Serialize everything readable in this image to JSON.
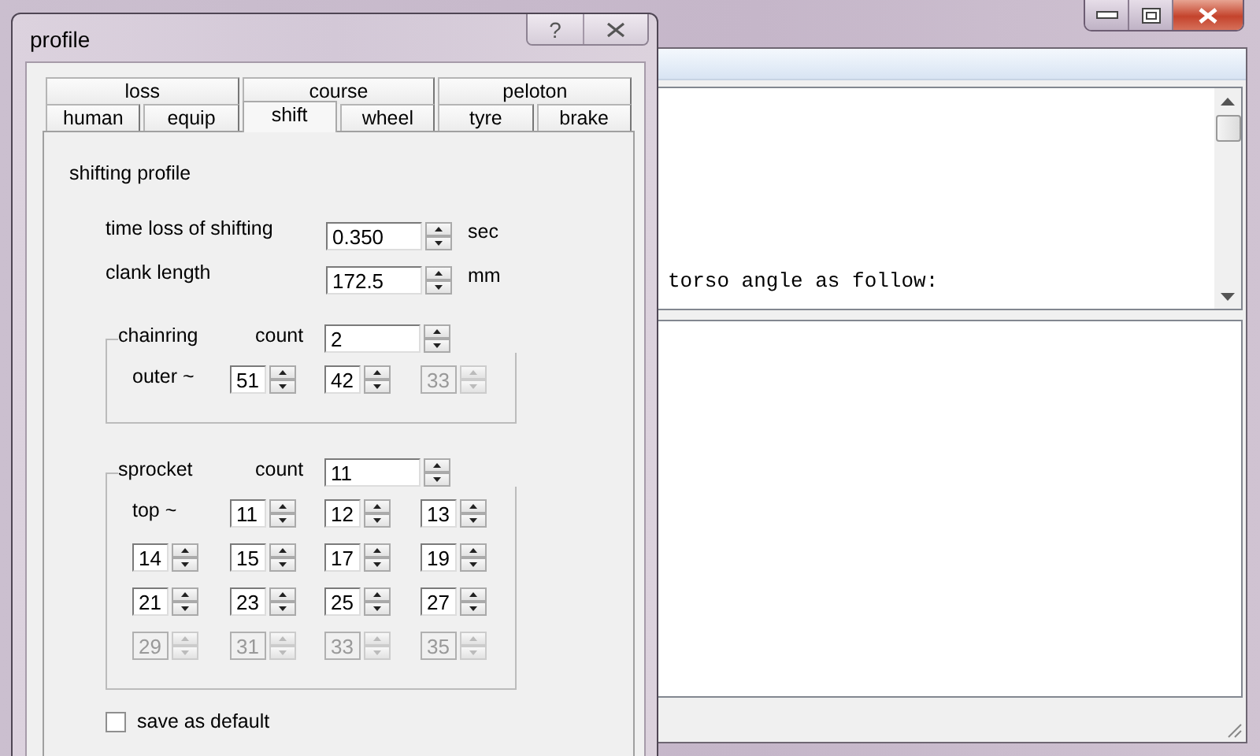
{
  "main_window": {
    "text_pane": {
      "lines": [
        "torso angle as follow:"
      ]
    }
  },
  "dialog": {
    "title": "profile",
    "help_button": "?",
    "tab_rows": [
      [
        {
          "label": "loss",
          "selected": false
        },
        {
          "label": "course",
          "selected": false
        },
        {
          "label": "peloton",
          "selected": false
        }
      ],
      [
        {
          "label": "human",
          "selected": false
        },
        {
          "label": "equip",
          "selected": false
        },
        {
          "label": "shift",
          "selected": true
        },
        {
          "label": "wheel",
          "selected": false
        },
        {
          "label": "tyre",
          "selected": false
        },
        {
          "label": "brake",
          "selected": false
        }
      ]
    ],
    "section_title": "shifting profile",
    "settings": [
      {
        "label": "time loss of shifting",
        "value": "0.350",
        "unit": "sec"
      },
      {
        "label": "clank length",
        "value": "172.5",
        "unit": "mm"
      }
    ],
    "groups": [
      {
        "legend": "chainring",
        "count_label": "count",
        "count": "2",
        "row_label": "outer ~",
        "items": [
          {
            "value": "51",
            "disabled": false
          },
          {
            "value": "42",
            "disabled": false
          },
          {
            "value": "33",
            "disabled": true
          }
        ]
      },
      {
        "legend": "sprocket",
        "count_label": "count",
        "count": "11",
        "row_label": "top ~",
        "items": [
          {
            "value": "11",
            "disabled": false
          },
          {
            "value": "12",
            "disabled": false
          },
          {
            "value": "13",
            "disabled": false
          },
          {
            "value": "14",
            "disabled": false
          },
          {
            "value": "15",
            "disabled": false
          },
          {
            "value": "17",
            "disabled": false
          },
          {
            "value": "19",
            "disabled": false
          },
          {
            "value": "21",
            "disabled": false
          },
          {
            "value": "23",
            "disabled": false
          },
          {
            "value": "25",
            "disabled": false
          },
          {
            "value": "27",
            "disabled": false
          },
          {
            "value": "29",
            "disabled": true
          },
          {
            "value": "31",
            "disabled": true
          },
          {
            "value": "33",
            "disabled": true
          },
          {
            "value": "35",
            "disabled": true
          }
        ]
      }
    ],
    "save_default": {
      "label": "save as default",
      "checked": false
    }
  }
}
